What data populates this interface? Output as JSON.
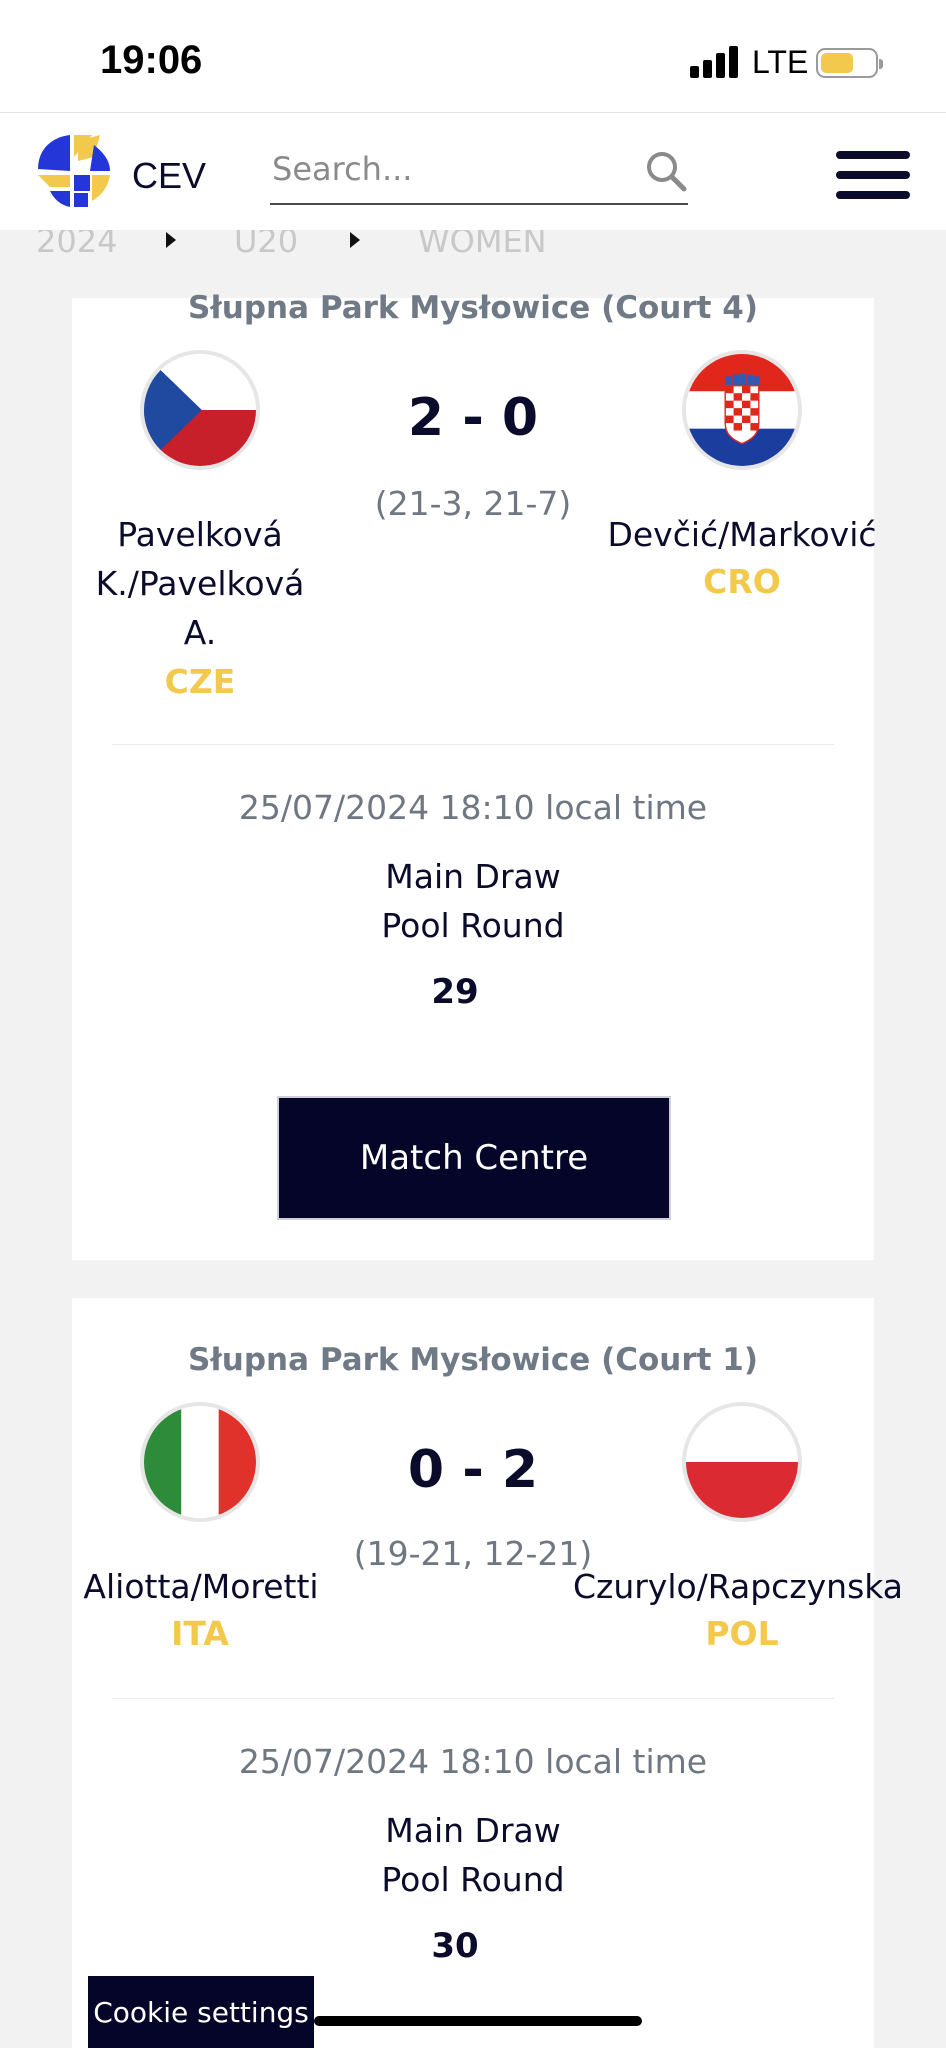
{
  "status_bar": {
    "time": "19:06",
    "network": "LTE",
    "battery_color": "#f2c94c"
  },
  "header": {
    "brand": "CEV",
    "search_placeholder": "Search...",
    "icons": [
      "cev-logo-icon",
      "search-icon",
      "hamburger-menu-icon"
    ]
  },
  "breadcrumb": {
    "items": [
      "2024",
      "U20",
      "WOMEN"
    ]
  },
  "matches": [
    {
      "venue": "Słupna Park Mysłowice (Court 4)",
      "score": "2 - 0",
      "sets": "(21-3, 21-7)",
      "home": {
        "name_lines": [
          "Pavelková",
          "K./Pavelková",
          "A."
        ],
        "country": "CZE",
        "flag": "czech-flag-icon"
      },
      "away": {
        "name_lines": [
          "Devčić/Marković"
        ],
        "country": "CRO",
        "flag": "croatia-flag-icon"
      },
      "datetime": "25/07/2024 18:10 local time",
      "round_lines": [
        "Main Draw",
        "Pool Round"
      ],
      "match_number": "29",
      "button_label": "Match Centre"
    },
    {
      "venue": "Słupna Park Mysłowice (Court 1)",
      "score": "0 - 2",
      "sets": "(19-21, 12-21)",
      "home": {
        "name_lines": [
          "Aliotta/Moretti"
        ],
        "country": "ITA",
        "flag": "italy-flag-icon"
      },
      "away": {
        "name_lines": [
          "Czurylo/Rapczynska"
        ],
        "country": "POL",
        "flag": "poland-flag-icon"
      },
      "datetime": "25/07/2024 18:10 local time",
      "round_lines": [
        "Main Draw",
        "Pool Round"
      ],
      "match_number": "30"
    }
  ],
  "cookie_label": "Cookie settings",
  "colors": {
    "navy": "#05052a",
    "accent_yellow": "#f2c94c",
    "muted_text": "#6f7783"
  }
}
